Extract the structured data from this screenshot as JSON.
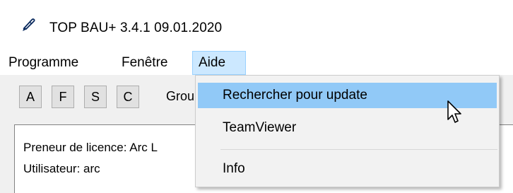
{
  "window": {
    "title": "TOP BAU+ 3.4.1  09.01.2020",
    "app_icon": "pen-icon"
  },
  "menubar": {
    "items": [
      {
        "label": "Programme"
      },
      {
        "label": "Fenêtre"
      },
      {
        "label": "Aide"
      }
    ],
    "open_menu": "Aide"
  },
  "toolbar": {
    "buttons": [
      {
        "label": "A"
      },
      {
        "label": "F"
      },
      {
        "label": "S"
      },
      {
        "label": "C"
      }
    ],
    "label": "Grou"
  },
  "panel": {
    "licensee": "Preneur de licence: Arc L",
    "user": "Utilisateur: arc"
  },
  "dropdown": {
    "items": [
      {
        "label": "Rechercher pour update",
        "highlighted": true
      },
      {
        "label": "TeamViewer"
      },
      {
        "label": "Info"
      }
    ]
  },
  "colors": {
    "menu_open_bg": "#cce8ff",
    "item_hover_bg": "#91c9f7",
    "toolbar_bg": "#f0f0f0"
  }
}
